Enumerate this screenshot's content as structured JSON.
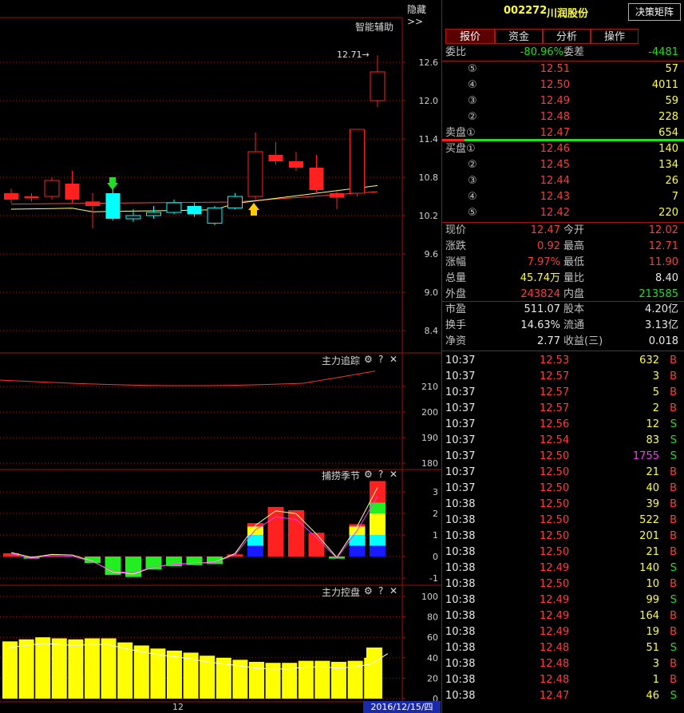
{
  "header": {
    "hide_label": "隐藏>>",
    "stock_code": "002272",
    "stock_name": "川润股份",
    "matrix_button": "决策矩阵"
  },
  "tabs": [
    "报价",
    "资金",
    "分析",
    "操作"
  ],
  "main_chart": {
    "title": "智能辅助",
    "high_marker": "12.71→",
    "yaxis": [
      "12.6",
      "12.0",
      "11.4",
      "10.8",
      "10.2",
      "9.6",
      "9.0",
      "8.4"
    ],
    "yvalues": [
      12.6,
      12.0,
      11.4,
      10.8,
      10.2,
      9.6,
      9.0,
      8.4
    ],
    "candles": [
      {
        "o": 10.55,
        "c": 10.45,
        "h": 10.62,
        "l": 10.4,
        "up": true
      },
      {
        "o": 10.47,
        "c": 10.5,
        "h": 10.55,
        "l": 10.42,
        "up": true
      },
      {
        "o": 10.5,
        "c": 10.75,
        "h": 10.8,
        "l": 10.45,
        "up": false,
        "hollow": true
      },
      {
        "o": 10.7,
        "c": 10.45,
        "h": 10.9,
        "l": 10.4,
        "up": true
      },
      {
        "o": 10.42,
        "c": 10.35,
        "h": 10.55,
        "l": 10.0,
        "down": true
      },
      {
        "o": 10.55,
        "c": 10.15,
        "h": 10.65,
        "l": 10.12,
        "cyan": true
      },
      {
        "o": 10.15,
        "c": 10.2,
        "h": 10.3,
        "l": 10.1,
        "cyan": true,
        "hollow": true
      },
      {
        "o": 10.2,
        "c": 10.25,
        "h": 10.35,
        "l": 10.15,
        "cyan": true,
        "hollow": true
      },
      {
        "o": 10.25,
        "c": 10.4,
        "h": 10.45,
        "l": 10.22,
        "cyan": true,
        "hollow": true
      },
      {
        "o": 10.35,
        "c": 10.22,
        "h": 10.4,
        "l": 10.18,
        "cyan": true
      },
      {
        "o": 10.08,
        "c": 10.32,
        "h": 10.35,
        "l": 10.05,
        "cyan": true,
        "hollow": true
      },
      {
        "o": 10.32,
        "c": 10.5,
        "h": 10.55,
        "l": 10.3,
        "cyan": true,
        "hollow": true
      },
      {
        "o": 10.5,
        "c": 11.2,
        "h": 11.5,
        "l": 10.45,
        "up": false,
        "hollow": true,
        "red": true
      },
      {
        "o": 11.15,
        "c": 11.05,
        "h": 11.35,
        "l": 11.0,
        "up": true
      },
      {
        "o": 11.05,
        "c": 10.95,
        "h": 11.2,
        "l": 10.9,
        "up": true
      },
      {
        "o": 10.95,
        "c": 10.6,
        "h": 11.15,
        "l": 10.55,
        "up": true
      },
      {
        "o": 10.55,
        "c": 10.48,
        "h": 10.58,
        "l": 10.3,
        "up": true
      },
      {
        "o": 10.55,
        "c": 11.55,
        "h": 11.55,
        "l": 10.5,
        "up": false,
        "hollow": true,
        "red": true
      },
      {
        "o": 12.0,
        "c": 12.45,
        "h": 12.71,
        "l": 11.9,
        "up": false,
        "hollow": true,
        "red": true
      }
    ]
  },
  "pane1": {
    "title": "主力追踪",
    "yaxis": [
      "210",
      "200",
      "190",
      "180"
    ],
    "yvalues": [
      210,
      200,
      190,
      180
    ]
  },
  "pane2": {
    "title": "捕捞季节",
    "yaxis": [
      "3",
      "2",
      "1",
      "0",
      "-1"
    ],
    "yvalues": [
      3,
      2,
      1,
      0,
      -1
    ]
  },
  "pane3": {
    "title": "主力控盘",
    "yaxis": [
      "100",
      "80",
      "60",
      "40",
      "20",
      "0"
    ],
    "yvalues": [
      100,
      80,
      60,
      40,
      20,
      0
    ],
    "bars": [
      48,
      52,
      54,
      55,
      54,
      52,
      53,
      50,
      47,
      43,
      40,
      37,
      35,
      33,
      31,
      30,
      30,
      32,
      34,
      34,
      34,
      36,
      40,
      48
    ]
  },
  "footer": {
    "x_label": "12",
    "date": "2016/12/15/四"
  },
  "quote": {
    "weibi_label": "委比",
    "weibi_value": "-80.96%",
    "weicha_label": "委差",
    "weicha_value": "-4481",
    "asks": [
      {
        "level": "⑤",
        "price": "12.51",
        "vol": "57"
      },
      {
        "level": "④",
        "price": "12.50",
        "vol": "4011"
      },
      {
        "level": "③",
        "price": "12.49",
        "vol": "59"
      },
      {
        "level": "②",
        "price": "12.48",
        "vol": "228"
      },
      {
        "level": "卖盘①",
        "price": "12.47",
        "vol": "654"
      }
    ],
    "bids": [
      {
        "level": "买盘①",
        "price": "12.46",
        "vol": "140"
      },
      {
        "level": "②",
        "price": "12.45",
        "vol": "134"
      },
      {
        "level": "③",
        "price": "12.44",
        "vol": "26"
      },
      {
        "level": "④",
        "price": "12.43",
        "vol": "7"
      },
      {
        "level": "⑤",
        "price": "12.42",
        "vol": "220"
      }
    ],
    "stats1": [
      {
        "l1": "现价",
        "v1": "12.47",
        "c1": "red",
        "l2": "今开",
        "v2": "12.02",
        "c2": "red"
      },
      {
        "l1": "涨跌",
        "v1": "0.92",
        "c1": "red",
        "l2": "最高",
        "v2": "12.71",
        "c2": "red"
      },
      {
        "l1": "涨幅",
        "v1": "7.97%",
        "c1": "red",
        "l2": "最低",
        "v2": "11.90",
        "c2": "red"
      },
      {
        "l1": "总量",
        "v1": "45.74万",
        "c1": "yellow",
        "l2": "量比",
        "v2": "8.40",
        "c2": "white"
      },
      {
        "l1": "外盘",
        "v1": "243824",
        "c1": "red",
        "l2": "内盘",
        "v2": "213585",
        "c2": "green"
      }
    ],
    "stats2": [
      {
        "l1": "市盈",
        "v1": "511.07",
        "l2": "股本",
        "v2": "4.20亿"
      },
      {
        "l1": "换手",
        "v1": "14.63%",
        "l2": "流通",
        "v2": "3.13亿"
      },
      {
        "l1": "净资",
        "v1": "2.77",
        "l2": "收益(三)",
        "v2": "0.018"
      }
    ]
  },
  "ticks": [
    {
      "t": "10:37",
      "p": "12.53",
      "v": "632",
      "s": "B"
    },
    {
      "t": "10:37",
      "p": "12.57",
      "v": "3",
      "s": "B"
    },
    {
      "t": "10:37",
      "p": "12.57",
      "v": "5",
      "s": "B"
    },
    {
      "t": "10:37",
      "p": "12.57",
      "v": "2",
      "s": "B"
    },
    {
      "t": "10:37",
      "p": "12.56",
      "v": "12",
      "s": "S"
    },
    {
      "t": "10:37",
      "p": "12.54",
      "v": "83",
      "s": "S"
    },
    {
      "t": "10:37",
      "p": "12.50",
      "v": "1755",
      "s": "S"
    },
    {
      "t": "10:37",
      "p": "12.50",
      "v": "21",
      "s": "B"
    },
    {
      "t": "10:37",
      "p": "12.50",
      "v": "40",
      "s": "B"
    },
    {
      "t": "10:38",
      "p": "12.50",
      "v": "39",
      "s": "B"
    },
    {
      "t": "10:38",
      "p": "12.50",
      "v": "522",
      "s": "B"
    },
    {
      "t": "10:38",
      "p": "12.50",
      "v": "201",
      "s": "B"
    },
    {
      "t": "10:38",
      "p": "12.50",
      "v": "21",
      "s": "B"
    },
    {
      "t": "10:38",
      "p": "12.49",
      "v": "140",
      "s": "S"
    },
    {
      "t": "10:38",
      "p": "12.50",
      "v": "10",
      "s": "B"
    },
    {
      "t": "10:38",
      "p": "12.49",
      "v": "99",
      "s": "S"
    },
    {
      "t": "10:38",
      "p": "12.49",
      "v": "164",
      "s": "B"
    },
    {
      "t": "10:38",
      "p": "12.49",
      "v": "19",
      "s": "B"
    },
    {
      "t": "10:38",
      "p": "12.48",
      "v": "51",
      "s": "S"
    },
    {
      "t": "10:38",
      "p": "12.48",
      "v": "3",
      "s": "B"
    },
    {
      "t": "10:38",
      "p": "12.48",
      "v": "1",
      "s": "B"
    },
    {
      "t": "10:38",
      "p": "12.47",
      "v": "46",
      "s": "S"
    }
  ],
  "colors": {
    "up": "#ff2020",
    "down": "#00ffff",
    "grid": "#a01010",
    "line": "#ffff66"
  }
}
